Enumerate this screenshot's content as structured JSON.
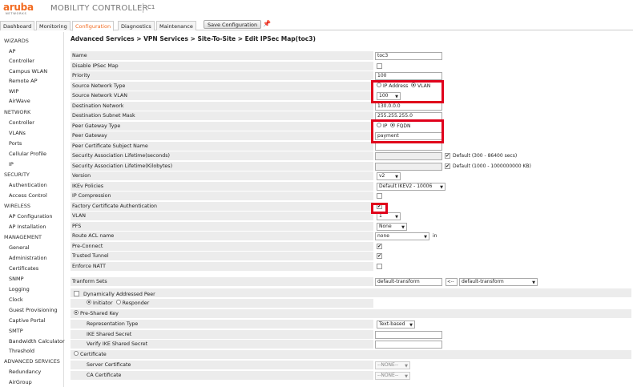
{
  "header": {
    "logo_text": "aruba",
    "logo_sub": "NETWORKS",
    "app_title": "MOBILITY CONTROLLER",
    "host": "C1",
    "save_label": "Save Configuration"
  },
  "tabs": [
    "Dashboard",
    "Monitoring",
    "Configuration",
    "Diagnostics",
    "Maintenance"
  ],
  "active_tab": "Configuration",
  "sidebar": {
    "items": [
      {
        "label": "WIZARDS",
        "type": "section"
      },
      {
        "label": "AP",
        "type": "sub"
      },
      {
        "label": "Controller",
        "type": "sub"
      },
      {
        "label": "Campus WLAN",
        "type": "sub"
      },
      {
        "label": "Remote AP",
        "type": "sub"
      },
      {
        "label": "WIP",
        "type": "sub"
      },
      {
        "label": "AirWave",
        "type": "sub"
      },
      {
        "label": "NETWORK",
        "type": "section"
      },
      {
        "label": "Controller",
        "type": "sub"
      },
      {
        "label": "VLANs",
        "type": "sub"
      },
      {
        "label": "Ports",
        "type": "sub"
      },
      {
        "label": "Cellular Profile",
        "type": "sub"
      },
      {
        "label": "IP",
        "type": "sub"
      },
      {
        "label": "SECURITY",
        "type": "section"
      },
      {
        "label": "Authentication",
        "type": "sub"
      },
      {
        "label": "Access Control",
        "type": "sub"
      },
      {
        "label": "WIRELESS",
        "type": "section"
      },
      {
        "label": "AP Configuration",
        "type": "sub"
      },
      {
        "label": "AP Installation",
        "type": "sub"
      },
      {
        "label": "MANAGEMENT",
        "type": "section"
      },
      {
        "label": "General",
        "type": "sub"
      },
      {
        "label": "Administration",
        "type": "sub"
      },
      {
        "label": "Certificates",
        "type": "sub"
      },
      {
        "label": "SNMP",
        "type": "sub"
      },
      {
        "label": "Logging",
        "type": "sub"
      },
      {
        "label": "Clock",
        "type": "sub"
      },
      {
        "label": "Guest Provisioning",
        "type": "sub"
      },
      {
        "label": "Captive Portal",
        "type": "sub"
      },
      {
        "label": "SMTP",
        "type": "sub"
      },
      {
        "label": "Bandwidth Calculator",
        "type": "sub"
      },
      {
        "label": "Threshold",
        "type": "sub"
      },
      {
        "label": "ADVANCED SERVICES",
        "type": "section"
      },
      {
        "label": "Redundancy",
        "type": "sub"
      },
      {
        "label": "AirGroup",
        "type": "sub"
      }
    ]
  },
  "breadcrumb": "Advanced Services > VPN Services > Site-To-Site > Edit IPSec Map(toc3)",
  "form": {
    "name": {
      "label": "Name",
      "value": "toc3"
    },
    "disable_map": {
      "label": "Disable IPSec Map",
      "checked": false
    },
    "priority": {
      "label": "Priority",
      "value": "100"
    },
    "src_net_type": {
      "label": "Source Network Type",
      "opt1": "IP Address",
      "opt2": "VLAN",
      "selected": "VLAN"
    },
    "src_vlan": {
      "label": "Source Network VLAN",
      "value": "100"
    },
    "dst_net": {
      "label": "Destination Network",
      "value": "130.0.0.0"
    },
    "dst_mask": {
      "label": "Destination Subnet Mask",
      "value": "255.255.255.0"
    },
    "peer_gw_type": {
      "label": "Peer Gateway Type",
      "opt1": "IP",
      "opt2": "FQDN",
      "selected": "FQDN"
    },
    "peer_gw": {
      "label": "Peer Gateway",
      "value": "payment"
    },
    "peer_cert_subject": {
      "label": "Peer Certificate Subject Name",
      "value": ""
    },
    "sa_lifetime_sec": {
      "label": "Security Association Lifetime(seconds)",
      "default_label": "Default (300 - 86400 secs)",
      "checked": true
    },
    "sa_lifetime_kb": {
      "label": "Security Association Lifetime(Kilobytes)",
      "default_label": "Default (1000 - 1000000000 KB)",
      "checked": true
    },
    "version": {
      "label": "Version",
      "value": "v2"
    },
    "ikev_policies": {
      "label": "IKEv Policies",
      "value": "Default IKEV2 - 10006"
    },
    "ip_compression": {
      "label": "IP Compression",
      "checked": false
    },
    "factory_cert_auth": {
      "label": "Factory Certificate Authentication",
      "checked": true
    },
    "vlan": {
      "label": "VLAN",
      "value": "1"
    },
    "pfs": {
      "label": "PFS",
      "value": "None"
    },
    "route_acl": {
      "label": "Route ACL name",
      "value": "none",
      "suffix": "in"
    },
    "pre_connect": {
      "label": "Pre-Connect",
      "checked": true
    },
    "trusted_tunnel": {
      "label": "Trusted Tunnel",
      "checked": true
    },
    "enforce_natt": {
      "label": "Enforce NATT",
      "checked": false
    },
    "transform_sets": {
      "label": "Tranform Sets",
      "value": "default-transform",
      "move_btn": "<--",
      "select_value": "default-transform"
    },
    "dyn_peer": {
      "label": "Dynamically Addressed Peer",
      "checked": false
    },
    "initiator_responder": {
      "opt1": "Initiator",
      "opt2": "Responder",
      "selected": "Initiator"
    },
    "pre_shared_key": {
      "label": "Pre-Shared Key",
      "selected": true
    },
    "rep_type": {
      "label": "Representation Type",
      "value": "Text-based"
    },
    "ike_secret": {
      "label": "IKE Shared Secret",
      "value": ""
    },
    "verify_secret": {
      "label": "Verify IKE Shared Secret",
      "value": ""
    },
    "certificate": {
      "label": "Certificate",
      "selected": false
    },
    "server_cert": {
      "label": "Server Certificate",
      "value": "--NONE--"
    },
    "ca_cert": {
      "label": "CA Certificate",
      "value": "--NONE--"
    }
  }
}
